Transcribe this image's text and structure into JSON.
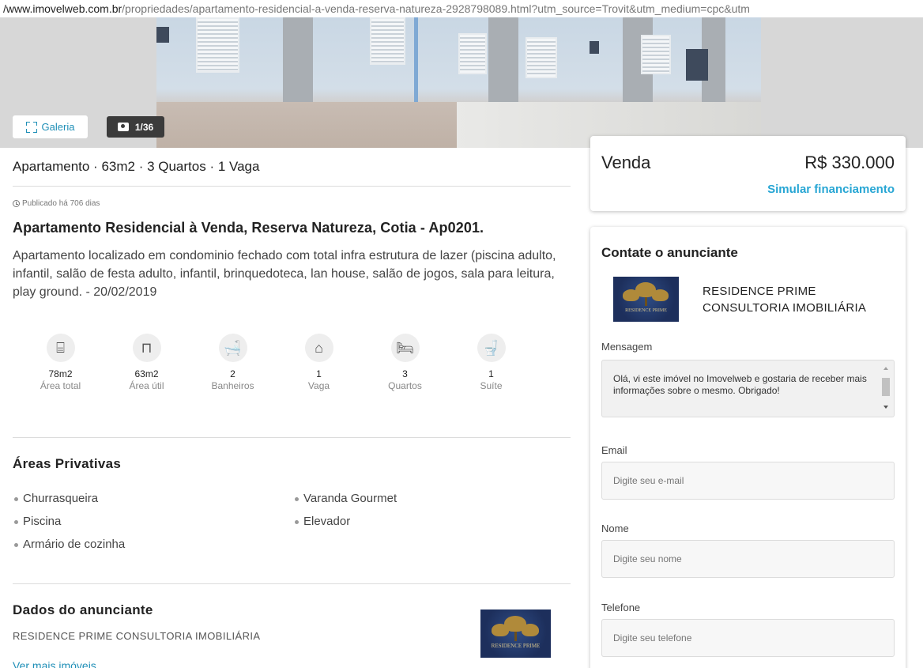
{
  "browser": {
    "url_domain": "/www.imovelweb.com.br",
    "url_rest": "/propriedades/apartamento-residencial-a-venda-reserva-natureza-2928798089.html?utm_source=Trovit&utm_medium=cpc&utm"
  },
  "gallery": {
    "button_label": "Galeria",
    "photo_count": "1/36"
  },
  "listing": {
    "summary": "Apartamento · 63m2 · 3 Quartos · 1 Vaga",
    "published": "Publicado há 706 dias",
    "title": "Apartamento Residencial à Venda, Reserva Natureza, Cotia - Ap0201.",
    "description": "Apartamento localizado em condominio fechado com total infra estrutura de lazer (piscina adulto, infantil, salão de festa adulto, infantil, brinquedoteca, lan house, salão de jogos, sala para leitura, play ground. - 20/02/2019"
  },
  "features": [
    {
      "icon": "total-area-icon",
      "glyph": "⌸",
      "value": "78m2",
      "label": "Área total"
    },
    {
      "icon": "useful-area-icon",
      "glyph": "⊓",
      "value": "63m2",
      "label": "Área útil"
    },
    {
      "icon": "bathtub-icon",
      "glyph": "🛁",
      "value": "2",
      "label": "Banheiros"
    },
    {
      "icon": "garage-icon",
      "glyph": "⌂",
      "value": "1",
      "label": "Vaga"
    },
    {
      "icon": "bed-icon",
      "glyph": "🛏",
      "value": "3",
      "label": "Quartos"
    },
    {
      "icon": "toilet-icon",
      "glyph": "🚽",
      "value": "1",
      "label": "Suíte"
    }
  ],
  "private_areas": {
    "title": "Áreas Privativas",
    "items": [
      "Churrasqueira",
      "Varanda Gourmet",
      "Piscina",
      "Elevador",
      "Armário de cozinha"
    ]
  },
  "advertiser": {
    "section_title": "Dados do anunciante",
    "name": "RESIDENCE PRIME CONSULTORIA IMOBILIÁRIA",
    "more_link": "Ver mais imóveis",
    "logo_text": "RESIDENCE PRIME"
  },
  "price_card": {
    "operation": "Venda",
    "price": "R$ 330.000",
    "simulate_link": "Simular financiamento"
  },
  "contact": {
    "title": "Contate o anunciante",
    "agency_line1": "RESIDENCE PRIME",
    "agency_line2": "CONSULTORIA IMOBILIÁRIA",
    "message_label": "Mensagem",
    "message_value": "Olá, vi este imóvel no Imovelweb e gostaria de receber mais informações sobre o mesmo. Obrigado!",
    "email_label": "Email",
    "email_placeholder": "Digite seu e-mail",
    "name_label": "Nome",
    "name_placeholder": "Digite seu nome",
    "phone_label": "Telefone",
    "phone_placeholder": "Digite seu telefone"
  },
  "colors": {
    "link": "#1f8fb7",
    "accent": "#27a6d4"
  }
}
